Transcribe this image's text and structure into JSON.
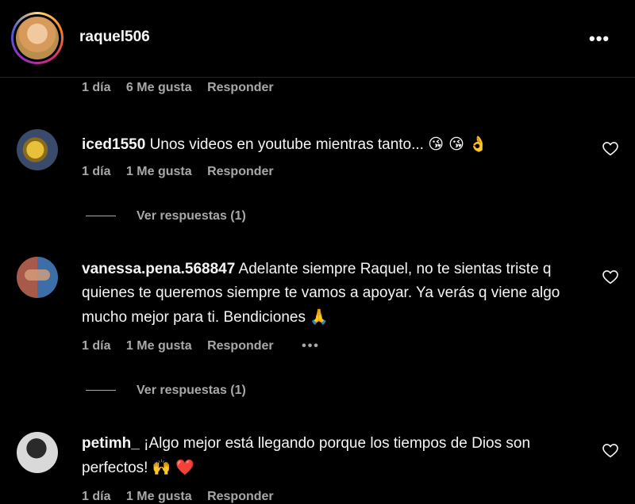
{
  "post": {
    "username": "raquel506",
    "more_label": "•••"
  },
  "top_meta": {
    "time": "1 día",
    "likes": "6 Me gusta",
    "reply": "Responder"
  },
  "comments": [
    {
      "user": "iced1550",
      "text": "Unos videos en youtube mientras tanto...",
      "emojis": "😘 😘 👌",
      "time": "1 día",
      "likes": "1 Me gusta",
      "reply": "Responder",
      "view_replies": "Ver respuestas (1)"
    },
    {
      "user": "vanessa.pena.568847",
      "text": "Adelante siempre Raquel, no te sientas triste q quienes te queremos siempre te vamos a apoyar. Ya verás q viene algo mucho mejor para ti. Bendiciones",
      "emojis": "🙏",
      "time": "1 día",
      "likes": "1 Me gusta",
      "reply": "Responder",
      "more": "•••",
      "view_replies": "Ver respuestas (1)"
    },
    {
      "user": "petimh_",
      "text": "¡Algo mejor está llegando porque los tiempos de Dios son perfectos!",
      "emojis": "🙌 ❤️",
      "time": "1 día",
      "likes": "1 Me gusta",
      "reply": "Responder"
    }
  ],
  "icons": {
    "heart": "heart-outline-icon",
    "more": "more-horizontal-icon"
  },
  "colors": {
    "background": "#000000",
    "text": "#f5f5f5",
    "muted": "#a8a8a8",
    "heart_emoji": "#e0245e"
  }
}
